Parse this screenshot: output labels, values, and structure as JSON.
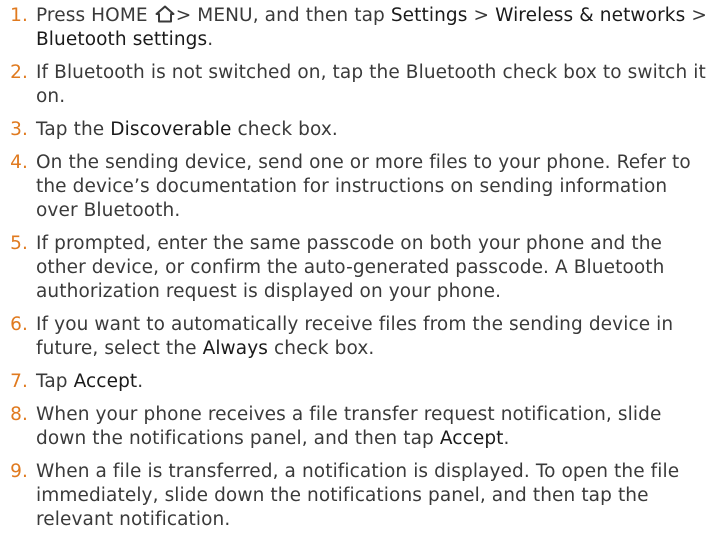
{
  "steps": [
    {
      "num": "1.",
      "parts": [
        "Press HOME ",
        "> MENU, and then tap ",
        "Settings",
        " > ",
        "Wireless & networks",
        " > ",
        "Bluetooth settings",
        "."
      ]
    },
    {
      "num": "2.",
      "parts": [
        "If Bluetooth is not switched on, tap the Bluetooth check box to switch it on."
      ]
    },
    {
      "num": "3.",
      "parts": [
        "Tap the ",
        "Discoverable",
        " check box."
      ]
    },
    {
      "num": "4.",
      "parts": [
        "On the sending device, send one or more files to your phone. Refer to the device’s documentation for instructions on sending information over Bluetooth."
      ]
    },
    {
      "num": "5.",
      "parts": [
        "If prompted, enter the same passcode on both your phone and the other device, or confirm the auto-generated passcode. A Bluetooth authorization request is displayed on your phone."
      ]
    },
    {
      "num": "6.",
      "parts": [
        "If you want to automatically receive files from the sending device in future, select the ",
        "Always",
        " check box."
      ]
    },
    {
      "num": "7.",
      "parts": [
        "Tap ",
        "Accept",
        "."
      ]
    },
    {
      "num": "8.",
      "parts": [
        "When your phone receives a file transfer request notification, slide down the notifications panel, and then tap ",
        "Accept",
        "."
      ]
    },
    {
      "num": "9.",
      "parts": [
        "When a file is transferred, a notification is displayed. To open the file immediately, slide down the notifications panel, and then tap the relevant notification."
      ]
    }
  ],
  "icons": {
    "home": "home-icon"
  },
  "colors": {
    "number": "#e07a1f",
    "text": "#3a3a3a"
  }
}
